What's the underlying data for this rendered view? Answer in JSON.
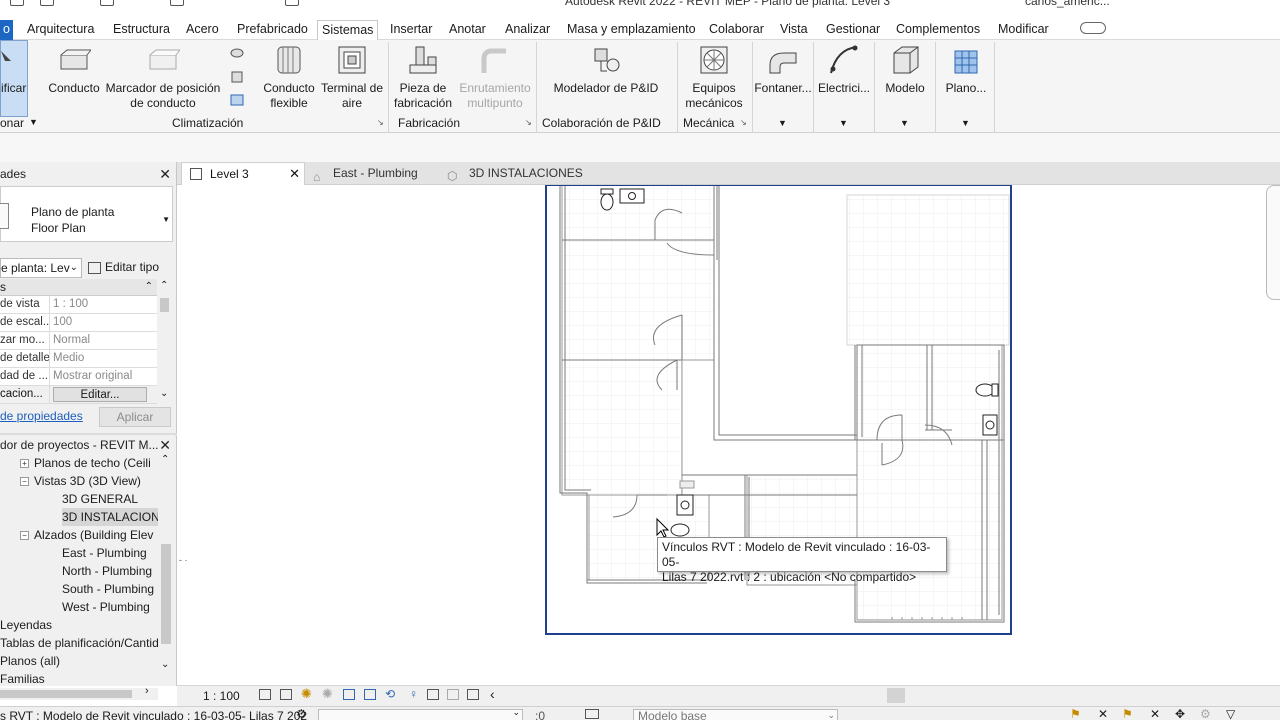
{
  "app": {
    "title": "Autodesk Revit 2022 - REVIT MEP - Plano de planta: Level 3",
    "user": "carlos_americ..."
  },
  "menu": {
    "modify_tab": "o",
    "tabs": [
      "Arquitectura",
      "Estructura",
      "Acero",
      "Prefabricado",
      "Sistemas",
      "Insertar",
      "Anotar",
      "Analizar",
      "Masa y emplazamiento",
      "Colaborar",
      "Vista",
      "Gestionar",
      "Complementos",
      "Modificar"
    ],
    "active": "Sistemas"
  },
  "ribbon": {
    "modify_btn": "ificar",
    "select_label": "onar",
    "buttons": {
      "conducto": "Conducto",
      "marcador1": "Marcador de posición",
      "marcador2": "de conducto",
      "flex1": "Conducto",
      "flex2": "flexible",
      "terminal1": "Terminal de",
      "terminal2": "aire",
      "pieza1": "Pieza de",
      "pieza2": "fabricación",
      "enrut1": "Enrutamiento",
      "enrut2": "multipunto",
      "pid": "Modelador de P&ID",
      "equipos1": "Equipos",
      "equipos2": "mecánicos",
      "fontaneria": "Fontaner...",
      "electricidad": "Electrici...",
      "modelo": "Modelo",
      "plano": "Plano..."
    },
    "panels": {
      "climatizacion": "Climatización",
      "fabricacion": "Fabricación",
      "pid": "Colaboración de P&ID",
      "mecanica": "Mecánica"
    }
  },
  "properties": {
    "header": "ades",
    "type1": "Plano de planta",
    "type2": "Floor Plan",
    "selector": "e planta: Lev",
    "edit_type": "Editar tipo",
    "section": "s",
    "rows": [
      {
        "k": "de vista",
        "v": "1 : 100"
      },
      {
        "k": "de escal...",
        "v": "100"
      },
      {
        "k": "zar mo...",
        "v": "Normal"
      },
      {
        "k": "de detalle",
        "v": "Medio"
      },
      {
        "k": "dad de ...",
        "v": "Mostrar original"
      }
    ],
    "last_row_key": "cacion...",
    "edit_btn": "Editar...",
    "help_link": "de propiedades",
    "apply": "Aplicar"
  },
  "browser": {
    "header": "dor de proyectos - REVIT M...",
    "items": [
      {
        "label": "Planos de techo (Ceili",
        "indent": 1,
        "box": "+"
      },
      {
        "label": "Vistas 3D (3D View)",
        "indent": 1,
        "box": "−"
      },
      {
        "label": "3D GENERAL",
        "indent": 2,
        "box": ""
      },
      {
        "label": "3D INSTALACIONE",
        "indent": 2,
        "box": "",
        "selected": true
      },
      {
        "label": "Alzados (Building Elev",
        "indent": 1,
        "box": "−"
      },
      {
        "label": "East - Plumbing",
        "indent": 2,
        "box": ""
      },
      {
        "label": "North - Plumbing",
        "indent": 2,
        "box": ""
      },
      {
        "label": "South - Plumbing",
        "indent": 2,
        "box": ""
      },
      {
        "label": "West - Plumbing",
        "indent": 2,
        "box": ""
      },
      {
        "label": "Leyendas",
        "indent": 0,
        "box": ""
      },
      {
        "label": "Tablas de planificación/Cantid",
        "indent": 0,
        "box": ""
      },
      {
        "label": "Planos (all)",
        "indent": 0,
        "box": ""
      },
      {
        "label": "Familias",
        "indent": 0,
        "box": ""
      }
    ]
  },
  "views": {
    "tabs": [
      "Level 3",
      "East - Plumbing",
      "3D INSTALACIONES"
    ]
  },
  "tooltip": {
    "line1": "Vínculos RVT : Modelo de Revit vinculado : 16-03-05-",
    "line2": "Lilas 7 2022.rvt : 2 : ubicación <No compartido>"
  },
  "status": {
    "scale": "1 : 100",
    "bottom_text": "s RVT : Modelo de Revit vinculado : 16-03-05- Lilas 7 202",
    "workset": ":0",
    "model": "Modelo base"
  },
  "colors": {
    "accent": "#1c66c4",
    "crop": "#1f3f8f"
  }
}
